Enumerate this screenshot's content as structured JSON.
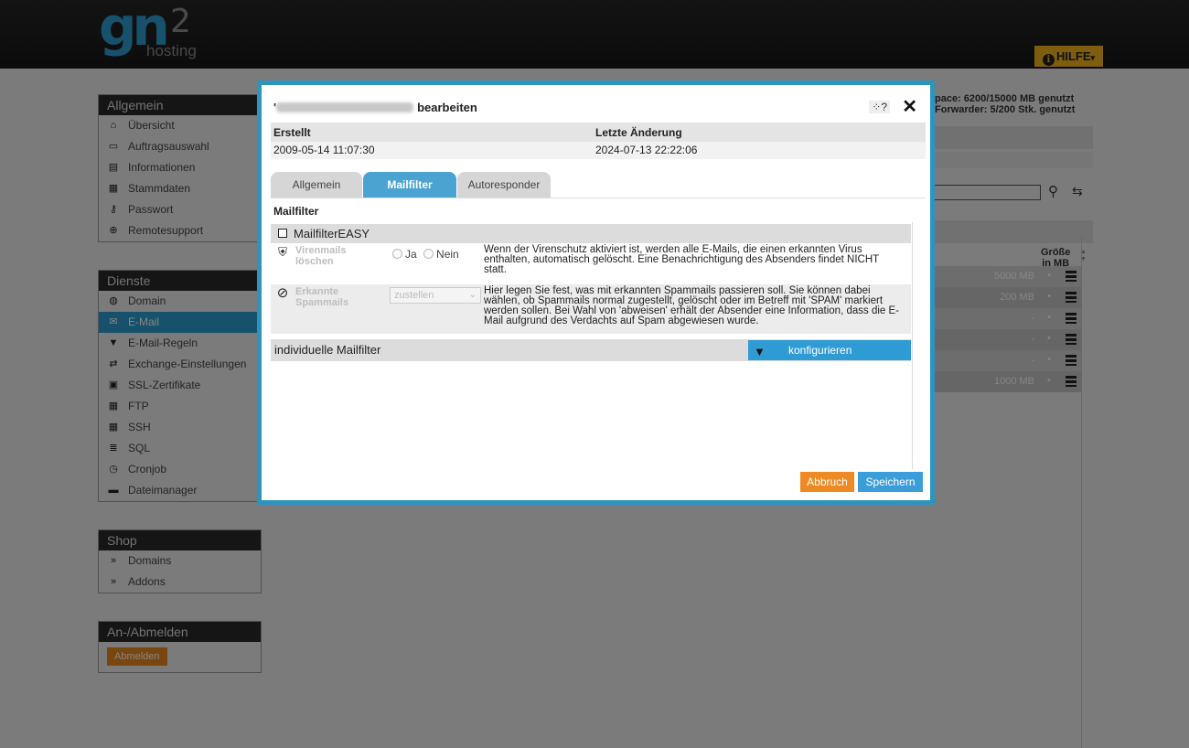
{
  "header": {
    "logo_gn": "gn",
    "logo_num": "2",
    "logo_sub": "hosting",
    "help_label": "HILFE",
    "help_chevron": "▾"
  },
  "sidebar": {
    "allgemein": {
      "title": "Allgemein",
      "items": [
        {
          "label": "Übersicht",
          "icon": "home-icon"
        },
        {
          "label": "Auftragsauswahl",
          "icon": "window-icon"
        },
        {
          "label": "Informationen",
          "icon": "document-icon"
        },
        {
          "label": "Stammdaten",
          "icon": "id-card-icon"
        },
        {
          "label": "Passwort",
          "icon": "key-icon"
        },
        {
          "label": "Remotesupport",
          "icon": "remote-icon"
        }
      ]
    },
    "dienste": {
      "title": "Dienste",
      "items": [
        {
          "label": "Domain",
          "icon": "globe-icon"
        },
        {
          "label": "E-Mail",
          "icon": "mail-icon",
          "active": true
        },
        {
          "label": "E-Mail-Regeln",
          "icon": "filter-icon"
        },
        {
          "label": "Exchange-Einstellungen",
          "icon": "exchange-icon"
        },
        {
          "label": "SSL-Zertifikate",
          "icon": "lock-icon"
        },
        {
          "label": "FTP",
          "icon": "ftp-icon"
        },
        {
          "label": "SSH",
          "icon": "ssh-icon"
        },
        {
          "label": "SQL",
          "icon": "database-icon"
        },
        {
          "label": "Cronjob",
          "icon": "clock-icon"
        },
        {
          "label": "Dateimanager",
          "icon": "folder-icon"
        }
      ]
    },
    "shop": {
      "title": "Shop",
      "items": [
        {
          "label": "Domains",
          "icon": "double-arrow-icon"
        },
        {
          "label": "Addons",
          "icon": "double-arrow-icon"
        }
      ]
    },
    "logout": {
      "title": "An-/Abmelden",
      "button": "Abmelden"
    }
  },
  "background": {
    "space_line": "pace: 6200/15000 MB genutzt",
    "forwarder_line": "Forwarder: 5/200 Stk. genutzt",
    "col_head_1": "Größe",
    "col_head_2": "in MB",
    "rows": [
      "5000 MB",
      "200 MB",
      "-",
      "-",
      "-",
      "1000 MB"
    ]
  },
  "modal": {
    "title_suffix": "bearbeiten",
    "help": "?",
    "close": "✕",
    "created_label": "Erstellt",
    "created_value": "2009-05-14 11:07:30",
    "changed_label": "Letzte Änderung",
    "changed_value": "2024-07-13 22:22:06",
    "tabs": [
      {
        "label": "Allgemein"
      },
      {
        "label": "Mailfilter",
        "active": true
      },
      {
        "label": "Autoresponder"
      }
    ],
    "section": "Mailfilter",
    "easy_label": "MailfilterEASY",
    "virus": {
      "label": "Virenmails löschen",
      "opt_yes": "Ja",
      "opt_no": "Nein",
      "description": "Wenn der Virenschutz aktiviert ist, werden alle E-Mails, die einen erkannten Virus enthalten, automatisch gelöscht. Eine Benachrichtigung des Absenders findet NICHT statt."
    },
    "spam": {
      "label": "Erkannte Spammails",
      "select_value": "zustellen",
      "description": "Hier legen Sie fest, was mit erkannten Spammails passieren soll. Sie können dabei wählen, ob Spammails normal zugestellt, gelöscht oder im Betreff mit 'SPAM' markiert werden sollen. Bei Wahl von 'abweisen' erhält der Absender eine Information, dass die E-Mail aufgrund des Verdachts auf Spam abgewiesen wurde."
    },
    "individual_label": "individuelle Mailfilter",
    "configure_label": "konfigurieren",
    "cancel_label": "Abbruch",
    "save_label": "Speichern"
  }
}
